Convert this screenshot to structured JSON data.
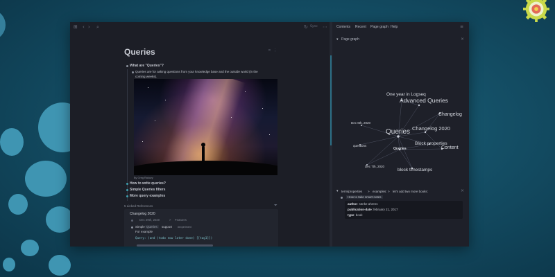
{
  "window": {
    "toolbar": {
      "search_icon": "search-icon",
      "back_icon": "chevron-left-icon",
      "forward_icon": "chevron-right-icon",
      "sync_icon": "refresh-icon",
      "right_text": "Sync"
    },
    "page": {
      "title": "Queries",
      "blocks": [
        {
          "text": "What are \"Queries\"?"
        },
        {
          "text_line1": "Queries are for asking questions from your knowledge base and the outside world (in the",
          "text_line2": "coming weeks)."
        },
        {
          "caption": "By Greg Rakozy"
        },
        {
          "text": "How to write queries?"
        },
        {
          "text": "Simple Queries filters"
        },
        {
          "text": "More query examples"
        }
      ],
      "linked_refs": {
        "header": "5 Linked References",
        "group_title": "Changelog 2020",
        "breadcrumb": [
          "Dec 29th, 2020",
          ">",
          "Features"
        ],
        "item_prefix": "Simple",
        "item_chip": "Queries",
        "item_suffix": "support",
        "item_tag": "#experiment",
        "item_line2": "For example",
        "code": "Query: (and (todo now later done) [[tag1]])"
      }
    }
  },
  "sidebar": {
    "tabs": [
      "Contents",
      "Recent",
      "Page graph",
      "Help"
    ],
    "graph_section_title": "Page graph",
    "graph_nodes": [
      {
        "label": "One year in Logseq",
        "size": 6.5
      },
      {
        "label": "Advanced Queries",
        "size": 8.5
      },
      {
        "label": "Changelog",
        "size": 7
      },
      {
        "label": "Dec 6th, 2020",
        "size": 4.5
      },
      {
        "label": "Queries",
        "size": 10
      },
      {
        "label": "Changelog 2020",
        "size": 7.5
      },
      {
        "label": "questions",
        "size": 4.5
      },
      {
        "label": "Queries",
        "size": 5
      },
      {
        "label": "Block properties",
        "size": 6.5
      },
      {
        "label": "Content",
        "size": 7
      },
      {
        "label": "Dec 7th, 2020",
        "size": 4.5
      },
      {
        "label": "block timestamps",
        "size": 6.5
      }
    ],
    "ref_panel": {
      "breadcrumb": [
        "term/properties",
        ">",
        "examples:",
        ">",
        "let's add two more books:"
      ],
      "item": "How to take smart notes",
      "props": [
        {
          "key": "author",
          "value": "sönke ahrens"
        },
        {
          "key": "publication-date",
          "value": "february 21, 2017"
        },
        {
          "key": "type",
          "value": "book"
        }
      ]
    }
  }
}
